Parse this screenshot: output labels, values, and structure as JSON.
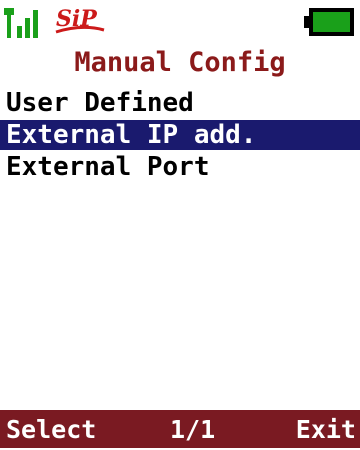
{
  "status": {
    "signal_icon": "signal-strength-icon",
    "sip_label": "SiP",
    "battery_icon": "battery-icon"
  },
  "screen": {
    "title": "Manual Config"
  },
  "menu": {
    "items": [
      {
        "label": "User Defined"
      },
      {
        "label": "External IP add."
      },
      {
        "label": "External Port"
      }
    ],
    "selected_index": 1
  },
  "softkeys": {
    "left": "Select",
    "middle": "1/1",
    "right": "Exit"
  },
  "colors": {
    "title": "#8b1a1a",
    "selection": "#1a1a6e",
    "softkey_bar": "#7a1a22",
    "battery_fill": "#1aa01a"
  }
}
